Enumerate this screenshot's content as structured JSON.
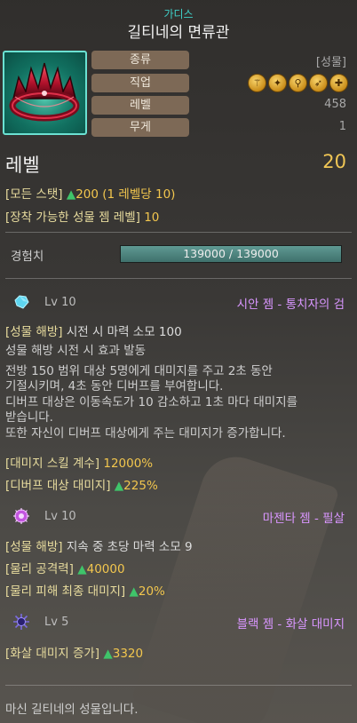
{
  "header": {
    "subtitle": "가디스",
    "title": "길티네의 면류관"
  },
  "item": {
    "icon": "crown-icon",
    "stats": {
      "type_label": "종류",
      "type_value": "[성물]",
      "job_label": "직업",
      "job_icons": [
        "job-class-1-icon",
        "job-class-2-icon",
        "job-class-3-icon",
        "job-class-4-icon",
        "job-class-5-icon"
      ],
      "level_label": "레벨",
      "level_value": "458",
      "weight_label": "무게",
      "weight_value": "1"
    }
  },
  "level": {
    "label": "레벨",
    "value": "20"
  },
  "bonus": {
    "all_stats": {
      "key": "[모든 스탯]",
      "arrow": "▲",
      "value": "200",
      "per_level": "(1 레벨당",
      "per_level_value": "10)"
    },
    "gem_level": {
      "key": "[장착 가능한 성물 젬 레벨]",
      "value": "10"
    }
  },
  "exp": {
    "label": "경험치",
    "text": "139000 / 139000",
    "current": 139000,
    "max": 139000,
    "fill_fraction": 1.0
  },
  "gems": [
    {
      "icon": "cyan-gem-icon",
      "level": "Lv 10",
      "name": "시안 젬 - 통치자의 검",
      "color": "#5ed6f0"
    },
    {
      "icon": "magenta-gem-icon",
      "level": "Lv 10",
      "name": "마젠타 젬 - 필살",
      "color": "#c455e0"
    },
    {
      "icon": "black-gem-icon",
      "level": "Lv 5",
      "name": "블랙 젬 - 화살 대미지",
      "color": "#5a4bb0"
    }
  ],
  "gem1_effects": {
    "active_key": "[성물 해방]",
    "active_text": "시전 시 마력 소모 100",
    "desc_lines": [
      "성물 해방 시전 시 효과 발동",
      "전방 150 범위 대상 5명에게 대미지를 주고 2초 동안",
      "기절시키며, 4초 동안 디버프를 부여합니다.",
      "디버프 대상은 이동속도가 10 감소하고 1초 마다 대미지를",
      "받습니다.",
      "또한 자신이 디버프 대상에게 주는 대미지가 증가합니다."
    ],
    "skill_coef_key": "[대미지 스킬 계수]",
    "skill_coef_value": "12000%",
    "debuff_dmg_key": "[디버프 대상 대미지]",
    "debuff_dmg_arrow": "▲",
    "debuff_dmg_value": "225%"
  },
  "gem2_effects": {
    "active_key": "[성물 해방]",
    "active_text": "지속 중 초당 마력 소모 9",
    "phys_atk_key": "[물리 공격력]",
    "phys_atk_arrow": "▲",
    "phys_atk_value": "40000",
    "phys_final_key": "[물리 피해 최종 대미지]",
    "phys_final_arrow": "▲",
    "phys_final_value": "20%"
  },
  "gem3_effects": {
    "arrow_dmg_key": "[화살 대미지 증가]",
    "arrow_dmg_arrow": "▲",
    "arrow_dmg_value": "3320"
  },
  "footer": {
    "text": "마신 길티네의 성물입니다."
  },
  "colors": {
    "accent_cyan": "#3fd0c8",
    "gold": "#f2c64e",
    "green": "#3fc46a",
    "purple": "#d996ff",
    "stat_key_bg": "#7d6956",
    "exp_fill": "#4f8882"
  }
}
